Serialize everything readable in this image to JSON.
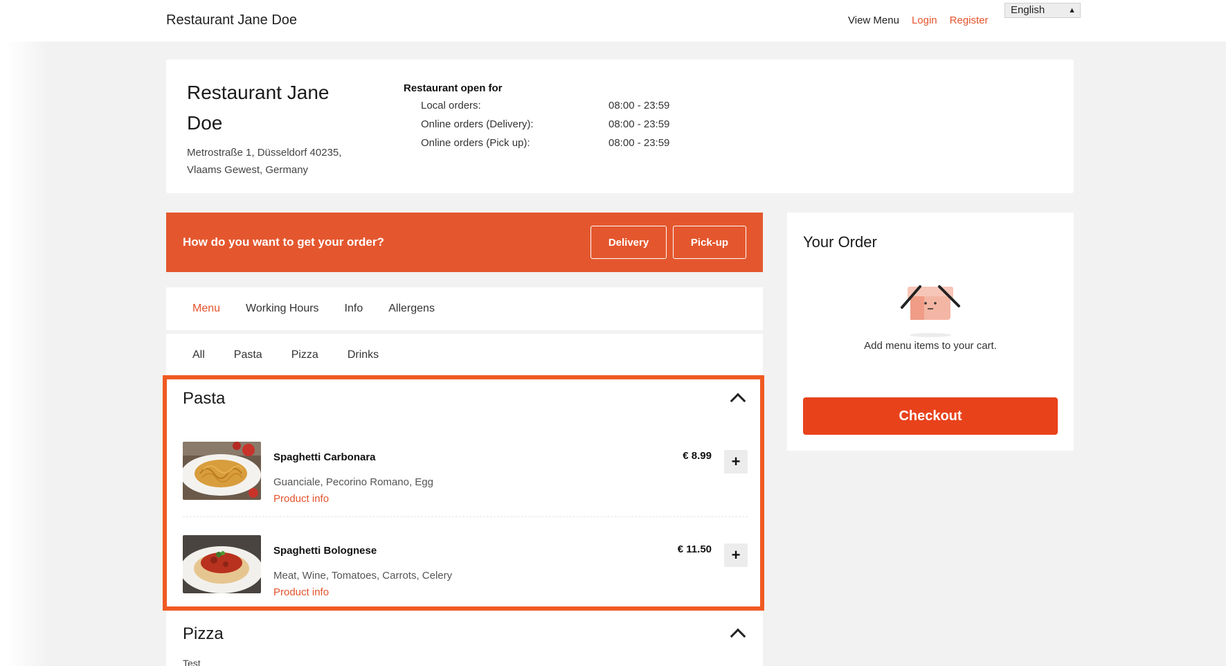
{
  "header": {
    "brand": "Restaurant Jane Doe",
    "nav": {
      "view_menu": "View Menu",
      "login": "Login",
      "register": "Register"
    },
    "language": "English"
  },
  "restaurant": {
    "name": "Restaurant Jane Doe",
    "address_line1": "Metrostraße 1, Düsseldorf 40235,",
    "address_line2": "Vlaams Gewest, Germany",
    "open_title": "Restaurant open for",
    "hours": [
      {
        "label": "Local orders:",
        "time": "08:00 - 23:59"
      },
      {
        "label": "Online orders (Delivery):",
        "time": "08:00 - 23:59"
      },
      {
        "label": "Online orders (Pick up):",
        "time": "08:00 - 23:59"
      }
    ]
  },
  "order_type": {
    "question": "How do you want to get your order?",
    "delivery_label": "Delivery",
    "pickup_label": "Pick-up"
  },
  "tabs": [
    "Menu",
    "Working Hours",
    "Info",
    "Allergens"
  ],
  "active_tab": "Menu",
  "categories": [
    "All",
    "Pasta",
    "Pizza",
    "Drinks"
  ],
  "pasta": {
    "title": "Pasta",
    "items": [
      {
        "name": "Spaghetti Carbonara",
        "description": "Guanciale, Pecorino Romano, Egg",
        "info_link": "Product info",
        "price": "€ 8.99",
        "add": "+"
      },
      {
        "name": "Spaghetti Bolognese",
        "description": "Meat, Wine, Tomatoes, Carrots, Celery",
        "info_link": "Product info",
        "price": "€ 11.50",
        "add": "+"
      }
    ]
  },
  "pizza": {
    "title": "Pizza",
    "description": "Test"
  },
  "order": {
    "title": "Your Order",
    "empty_message": "Add menu items to your cart.",
    "checkout_label": "Checkout"
  },
  "colors": {
    "accent": "#e4572e",
    "checkout": "#e8421b",
    "highlight_border": "#f05a23"
  }
}
